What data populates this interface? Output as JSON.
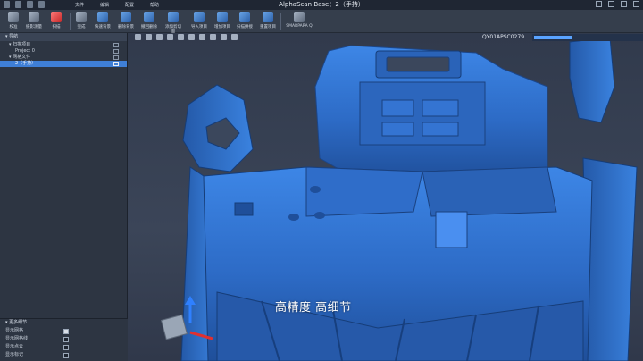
{
  "window": {
    "title": "AlphaScan Base：2（手持）",
    "menu": [
      "文件",
      "编辑",
      "配置",
      "帮助"
    ]
  },
  "toolbar": {
    "buttons": [
      {
        "label": "校准",
        "icon": "calibrate-icon"
      },
      {
        "label": "摄影测量",
        "icon": "photogrammetry-icon"
      },
      {
        "label": "扫描",
        "icon": "scan-icon"
      },
      {
        "label": "完成",
        "icon": "finish-icon"
      },
      {
        "label": "快速背景",
        "icon": "quick-background-icon"
      },
      {
        "label": "删除背景",
        "icon": "delete-background-icon"
      },
      {
        "label": "撤回删除",
        "icon": "undo-delete-icon"
      },
      {
        "label": "添加剪切面",
        "icon": "add-cut-plane-icon"
      },
      {
        "label": "导入项目",
        "icon": "import-project-icon"
      },
      {
        "label": "增加项目",
        "icon": "add-project-icon"
      },
      {
        "label": "扫描拼接",
        "icon": "scan-stitch-icon"
      },
      {
        "label": "重置项目",
        "icon": "reset-project-icon"
      },
      {
        "label": "SMARPARA Q",
        "icon": "smarpara-icon"
      }
    ]
  },
  "navigator": {
    "header": "导航",
    "items": [
      {
        "label": "扫描项目",
        "indent": 1,
        "selected": false
      },
      {
        "label": "Project 0",
        "indent": 2,
        "selected": false
      },
      {
        "label": "网格文件",
        "indent": 1,
        "selected": false
      },
      {
        "label": "2（手持）",
        "indent": 2,
        "selected": true
      }
    ]
  },
  "details": {
    "header": "更多细节",
    "rows": [
      {
        "label": "显示网格",
        "checked": true
      },
      {
        "label": "显示网格线",
        "checked": false
      },
      {
        "label": "显示点云",
        "checked": false
      },
      {
        "label": "显示标记",
        "checked": false
      }
    ]
  },
  "viewport": {
    "scanner_id": "QY01APSC0279",
    "caption": "高精度  高细节",
    "progress": 0.35
  },
  "colors": {
    "model": "#2f6fcc",
    "selection": "#3f7fd6"
  }
}
